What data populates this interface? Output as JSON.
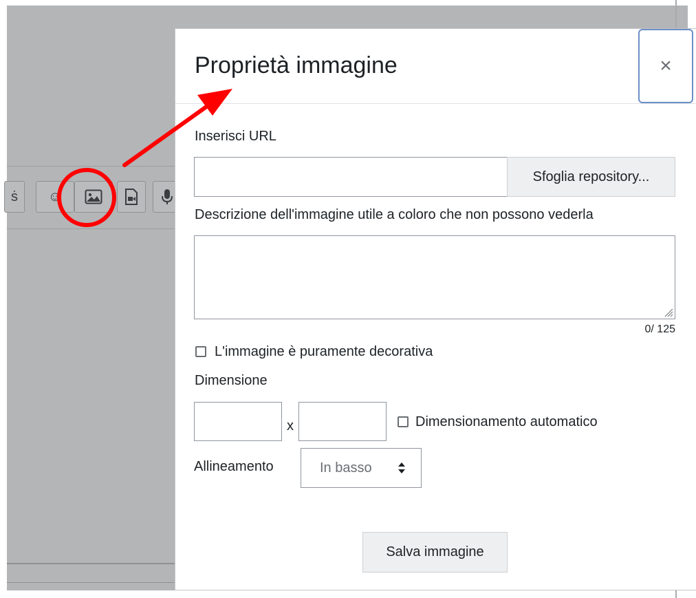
{
  "toolbar": {
    "buttons": [
      {
        "icon": "spellcheck-icon",
        "glyph": "ṡ"
      },
      {
        "icon": "emoji-icon",
        "glyph": "☺"
      },
      {
        "icon": "image-icon"
      },
      {
        "icon": "video-file-icon"
      },
      {
        "icon": "microphone-icon"
      }
    ],
    "highlighted": "image-icon"
  },
  "annotation": {
    "color": "#ff0000",
    "shapes": [
      "red-circle",
      "red-arrow"
    ]
  },
  "modal": {
    "title": "Proprietà immagine",
    "close_symbol": "×",
    "url": {
      "label": "Inserisci URL",
      "value": "",
      "browse_label": "Sfoglia repository..."
    },
    "description": {
      "label": "Descrizione dell'immagine utile a coloro che non possono vederla",
      "value": "",
      "counter": "0/ 125"
    },
    "decorative": {
      "label": "L'immagine è puramente decorativa",
      "checked": false
    },
    "size": {
      "label": "Dimensione",
      "width_value": "",
      "height_value": "",
      "separator": "x",
      "auto_label": "Dimensionamento automatico",
      "auto_checked": false
    },
    "alignment": {
      "label": "Allineamento",
      "selected": "In basso"
    },
    "save_label": "Salva immagine"
  },
  "colors": {
    "backdrop": "#b3b5b7",
    "focus_border": "#6c8ec7",
    "button_bg": "#eeeff0",
    "annotation": "#ff0000"
  }
}
